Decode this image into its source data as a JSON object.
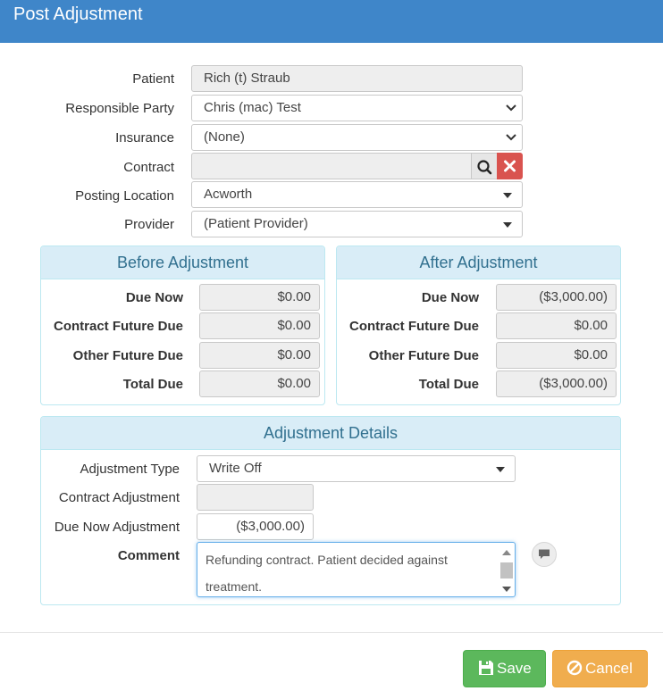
{
  "dialog": {
    "title": "Post Adjustment"
  },
  "form": {
    "patient": {
      "label": "Patient",
      "value": "Rich (t) Straub"
    },
    "responsible_party": {
      "label": "Responsible Party",
      "value": "Chris (mac) Test"
    },
    "insurance": {
      "label": "Insurance",
      "value": "(None)"
    },
    "contract": {
      "label": "Contract",
      "value": ""
    },
    "posting_location": {
      "label": "Posting Location",
      "value": "Acworth"
    },
    "provider": {
      "label": "Provider",
      "value": "(Patient Provider)"
    }
  },
  "before": {
    "title": "Before Adjustment",
    "rows": [
      {
        "label": "Due Now",
        "value": "$0.00"
      },
      {
        "label": "Contract Future Due",
        "value": "$0.00"
      },
      {
        "label": "Other Future Due",
        "value": "$0.00"
      },
      {
        "label": "Total Due",
        "value": "$0.00"
      }
    ]
  },
  "after": {
    "title": "After Adjustment",
    "rows": [
      {
        "label": "Due Now",
        "value": "($3,000.00)"
      },
      {
        "label": "Contract Future Due",
        "value": "$0.00"
      },
      {
        "label": "Other Future Due",
        "value": "$0.00"
      },
      {
        "label": "Total Due",
        "value": "($3,000.00)"
      }
    ]
  },
  "details": {
    "title": "Adjustment Details",
    "adjustment_type": {
      "label": "Adjustment Type",
      "value": "Write Off"
    },
    "contract_adjustment": {
      "label": "Contract Adjustment",
      "value": ""
    },
    "due_now_adjustment": {
      "label": "Due Now Adjustment",
      "value": "($3,000.00)"
    },
    "comment": {
      "label": "Comment",
      "value": "Refunding contract.  Patient decided against treatment."
    }
  },
  "footer": {
    "save_label": "Save",
    "cancel_label": "Cancel"
  },
  "colors": {
    "header": "#3f86c9",
    "save": "#5cb85c",
    "cancel": "#f0ad4e",
    "clear": "#d9534f",
    "panel_head": "#d9edf7"
  },
  "icons": [
    "search-icon",
    "clear-icon",
    "chevron-down-icon",
    "caret-down-icon",
    "comment-icon",
    "save-icon",
    "cancel-icon"
  ]
}
